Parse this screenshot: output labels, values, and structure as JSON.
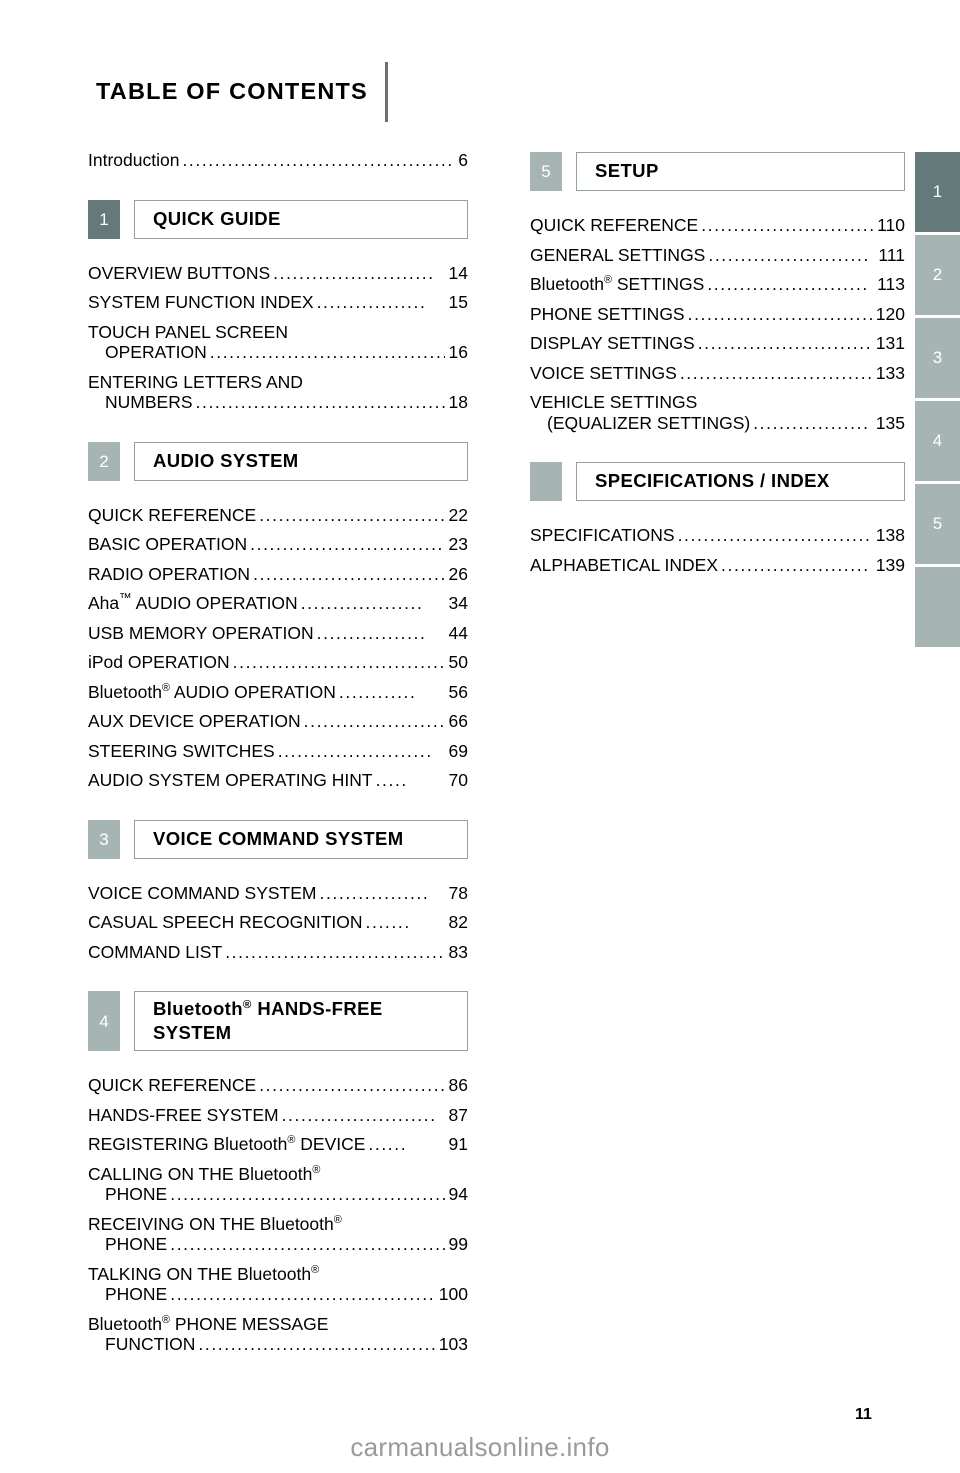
{
  "page": {
    "title": "TABLE OF CONTENTS",
    "folio": "11",
    "watermark": "carmanualsonline.info"
  },
  "colors": {
    "badge_active": "#63797a",
    "badge_inactive": "#a6b5b4",
    "box_border": "#8fa2a1",
    "rule": "#6d6e71",
    "watermark_text": "#9a9a9a"
  },
  "intro": {
    "label": "Introduction",
    "leader": "................................................",
    "page": "6"
  },
  "left_column": {
    "chapters": [
      {
        "number": "1",
        "title_lines": [
          "QUICK GUIDE"
        ],
        "entries": [
          {
            "label": "OVERVIEW BUTTONS",
            "leader": ".........................",
            "page": "14",
            "wrapped": false
          },
          {
            "label": "SYSTEM FUNCTION INDEX",
            "leader": ".................",
            "page": "15",
            "wrapped": false
          },
          {
            "label": "TOUCH PANEL SCREEN",
            "label2": "OPERATION",
            "leader": "........................................",
            "page": "16",
            "wrapped": true
          },
          {
            "label": "ENTERING LETTERS AND",
            "label2": "NUMBERS",
            "leader": "..........................................",
            "page": "18",
            "wrapped": true
          }
        ]
      },
      {
        "number": "2",
        "title_lines": [
          "AUDIO SYSTEM"
        ],
        "entries": [
          {
            "label": "QUICK REFERENCE",
            "leader": ".............................",
            "page": "22",
            "wrapped": false
          },
          {
            "label": "BASIC OPERATION",
            "leader": "...............................",
            "page": "23",
            "wrapped": false
          },
          {
            "label": "RADIO OPERATION",
            "leader": "..............................",
            "page": "26",
            "wrapped": false
          },
          {
            "label": "Aha™ AUDIO OPERATION",
            "leader": "...................",
            "page": "34",
            "wrapped": false
          },
          {
            "label": "USB MEMORY OPERATION",
            "leader": ".................",
            "page": "44",
            "wrapped": false
          },
          {
            "label": "iPod OPERATION",
            "leader": "...................................",
            "page": "50",
            "wrapped": false
          },
          {
            "label": "Bluetooth® AUDIO OPERATION",
            "leader": "............",
            "page": "56",
            "wrapped": false
          },
          {
            "label": "AUX DEVICE OPERATION",
            "leader": ".......................",
            "page": "66",
            "wrapped": false
          },
          {
            "label": "STEERING SWITCHES",
            "leader": "........................",
            "page": "69",
            "wrapped": false
          },
          {
            "label": "AUDIO SYSTEM OPERATING HINT",
            "leader": ".....",
            "page": "70",
            "wrapped": false
          }
        ]
      },
      {
        "number": "3",
        "title_lines": [
          "VOICE COMMAND SYSTEM"
        ],
        "entries": [
          {
            "label": "VOICE COMMAND SYSTEM",
            "leader": ".................",
            "page": "78",
            "wrapped": false
          },
          {
            "label": "CASUAL SPEECH RECOGNITION",
            "leader": ".......",
            "page": "82",
            "wrapped": false
          },
          {
            "label": "COMMAND LIST",
            "leader": "...................................",
            "page": "83",
            "wrapped": false
          }
        ]
      },
      {
        "number": "4",
        "title_lines": [
          "Bluetooth® HANDS-FREE",
          "SYSTEM"
        ],
        "entries": [
          {
            "label": "QUICK REFERENCE",
            "leader": ".............................",
            "page": "86",
            "wrapped": false
          },
          {
            "label": "HANDS-FREE SYSTEM",
            "leader": "........................",
            "page": "87",
            "wrapped": false
          },
          {
            "label": "REGISTERING Bluetooth® DEVICE",
            "leader": "......",
            "page": "91",
            "wrapped": false
          },
          {
            "label": "CALLING ON THE Bluetooth®",
            "label2": "PHONE",
            "leader": "................................................",
            "page": "94",
            "wrapped": true
          },
          {
            "label": "RECEIVING ON THE Bluetooth®",
            "label2": "PHONE",
            "leader": "................................................",
            "page": "99",
            "wrapped": true
          },
          {
            "label": "TALKING ON THE Bluetooth®",
            "label2": "PHONE",
            "leader": ".............................................",
            "page": "100",
            "wrapped": true
          },
          {
            "label": "Bluetooth® PHONE MESSAGE",
            "label2": "FUNCTION",
            "leader": "........................................",
            "page": "103",
            "wrapped": true
          }
        ]
      }
    ]
  },
  "right_column": {
    "chapters": [
      {
        "number": "5",
        "title_lines": [
          "SETUP"
        ],
        "entries": [
          {
            "label": "QUICK REFERENCE",
            "leader": "...........................",
            "page": "110",
            "wrapped": false
          },
          {
            "label": "GENERAL SETTINGS",
            "leader": ".........................",
            "page": "111",
            "wrapped": false
          },
          {
            "label": "Bluetooth® SETTINGS",
            "leader": ".........................",
            "page": "113",
            "wrapped": false
          },
          {
            "label": "PHONE SETTINGS",
            "leader": "..............................",
            "page": "120",
            "wrapped": false
          },
          {
            "label": "DISPLAY SETTINGS",
            "leader": "...........................",
            "page": "131",
            "wrapped": false
          },
          {
            "label": "VOICE SETTINGS",
            "leader": "................................",
            "page": "133",
            "wrapped": false
          },
          {
            "label": "VEHICLE SETTINGS",
            "label2": "(EQUALIZER SETTINGS)",
            "leader": "..................",
            "page": "135",
            "wrapped": true
          }
        ]
      },
      {
        "number": "",
        "title_lines": [
          "SPECIFICATIONS / INDEX"
        ],
        "entries": [
          {
            "label": "SPECIFICATIONS",
            "leader": "................................",
            "page": "138",
            "wrapped": false
          },
          {
            "label": "ALPHABETICAL INDEX",
            "leader": ".......................",
            "page": "139",
            "wrapped": false
          }
        ]
      }
    ]
  },
  "tab_strip": {
    "tabs": [
      {
        "label": "1",
        "active": true
      },
      {
        "label": "2",
        "active": false
      },
      {
        "label": "3",
        "active": false
      },
      {
        "label": "4",
        "active": false
      },
      {
        "label": "5",
        "active": false
      },
      {
        "label": "",
        "active": false
      }
    ]
  }
}
